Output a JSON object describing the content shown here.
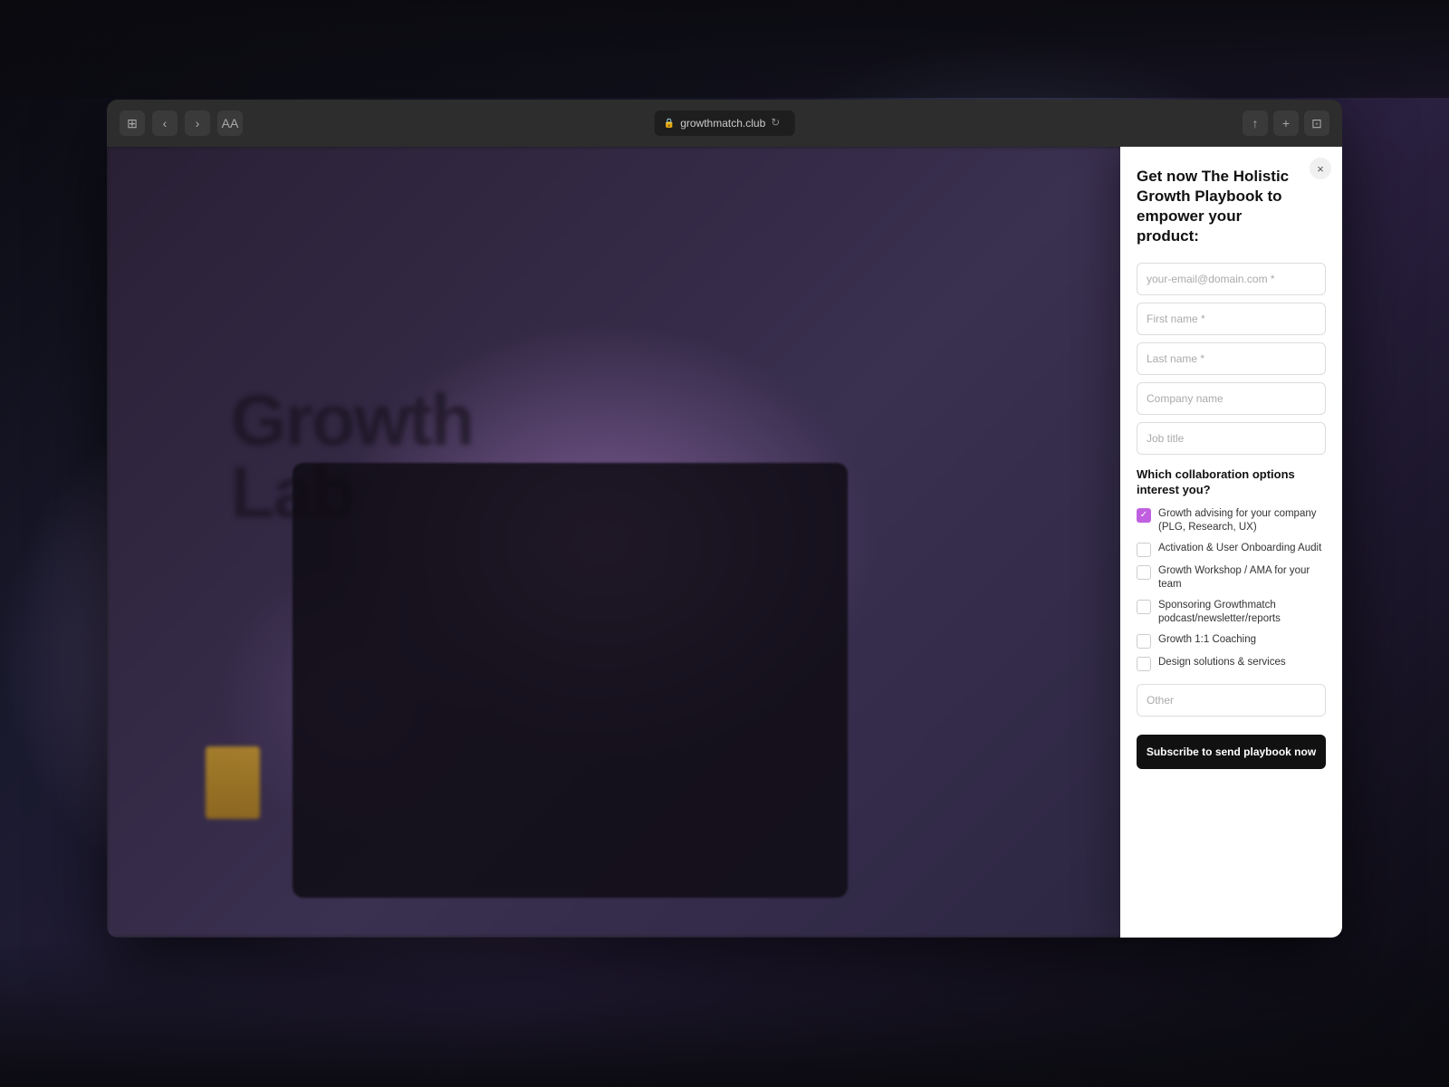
{
  "browser": {
    "url": "growthmatch.club",
    "tab_icon": "⊞",
    "back_label": "‹",
    "forward_label": "›",
    "aa_label": "AA",
    "reload_label": "↻",
    "share_label": "↑",
    "new_tab_label": "+",
    "extensions_label": "⊡"
  },
  "modal": {
    "title": "Get now The Holistic Growth Playbook to empower your product:",
    "close_label": "×",
    "email_placeholder": "your-email@domain.com *",
    "first_name_placeholder": "First name *",
    "last_name_placeholder": "Last name *",
    "company_placeholder": "Company name",
    "job_title_placeholder": "Job title",
    "section_title": "Which collaboration options interest you?",
    "checkboxes": [
      {
        "id": "cb1",
        "label": "Growth advising for your company (PLG, Research, UX)",
        "checked": true
      },
      {
        "id": "cb2",
        "label": "Activation & User Onboarding Audit",
        "checked": false
      },
      {
        "id": "cb3",
        "label": "Growth Workshop / AMA for your team",
        "checked": false
      },
      {
        "id": "cb4",
        "label": "Sponsoring Growthmatch podcast/newsletter/reports",
        "checked": false
      },
      {
        "id": "cb5",
        "label": "Growth 1:1 Coaching",
        "checked": false
      },
      {
        "id": "cb6",
        "label": "Design solutions & services",
        "checked": false
      }
    ],
    "other_placeholder": "Other",
    "submit_label": "Subscribe to send playbook now"
  },
  "page": {
    "blurred_text": "Growth\nLab",
    "accent_color": "#c060e0"
  }
}
